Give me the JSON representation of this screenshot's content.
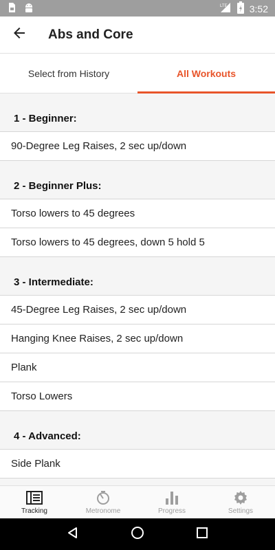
{
  "status_bar": {
    "time": "3:52",
    "network": "LTE",
    "icons": [
      "sim-card-icon",
      "android-icon",
      "signal-icon",
      "battery-icon"
    ]
  },
  "app_bar": {
    "title": "Abs and Core",
    "back_icon": "arrow-back-icon"
  },
  "tabs": [
    {
      "label": "Select from History",
      "active": false
    },
    {
      "label": "All Workouts",
      "active": true
    }
  ],
  "colors": {
    "accent": "#e8542a",
    "status_bar": "#9e9e9e",
    "section_background": "#f5f5f5"
  },
  "sections": [
    {
      "header": "1 - Beginner:",
      "items": [
        "90-Degree Leg Raises, 2 sec up/down"
      ]
    },
    {
      "header": "2 - Beginner Plus:",
      "items": [
        "Torso lowers to 45 degrees",
        "Torso lowers to 45 degrees, down 5 hold 5"
      ]
    },
    {
      "header": "3 - Intermediate:",
      "items": [
        "45-Degree Leg Raises, 2 sec up/down",
        "Hanging Knee Raises, 2 sec up/down",
        "Plank",
        "Torso Lowers"
      ]
    },
    {
      "header": "4 - Advanced:",
      "items": [
        "Side Plank"
      ]
    }
  ],
  "bottom_nav": [
    {
      "label": "Tracking",
      "icon": "tracking-icon",
      "active": true
    },
    {
      "label": "Metronome",
      "icon": "metronome-icon",
      "active": false
    },
    {
      "label": "Progress",
      "icon": "bar-chart-icon",
      "active": false
    },
    {
      "label": "Settings",
      "icon": "gear-icon",
      "active": false
    }
  ]
}
